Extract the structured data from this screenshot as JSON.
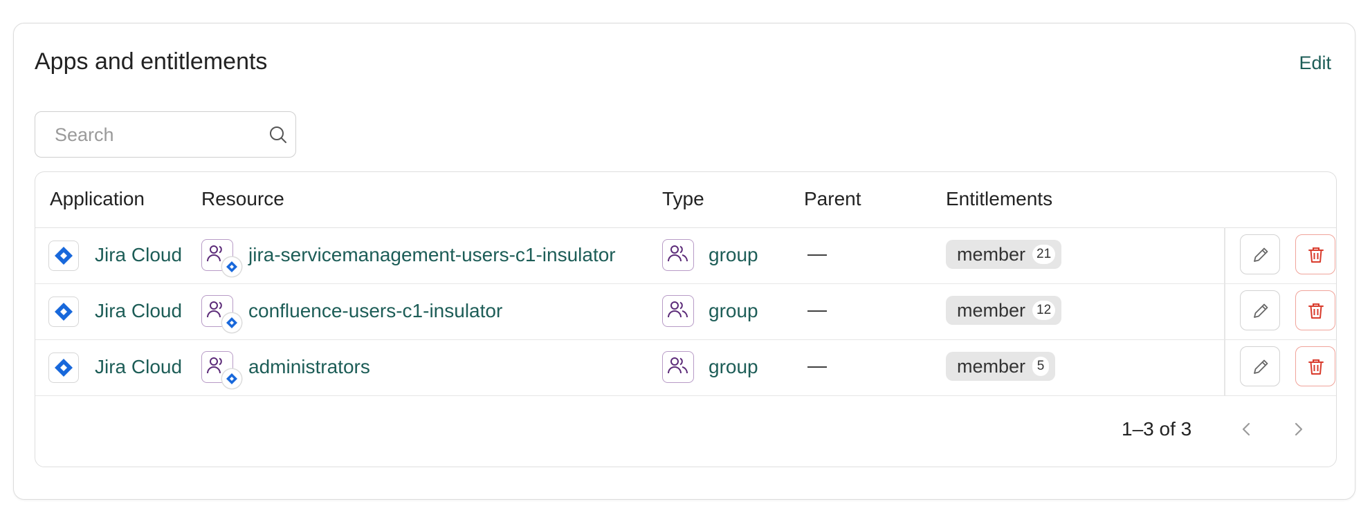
{
  "section": {
    "title": "Apps and entitlements",
    "edit_label": "Edit"
  },
  "search": {
    "placeholder": "Search",
    "value": ""
  },
  "table": {
    "columns": [
      "Application",
      "Resource",
      "Type",
      "Parent",
      "Entitlements"
    ],
    "rows": [
      {
        "application": "Jira Cloud",
        "resource": "jira-servicemanagement-users-c1-insulator",
        "type": "group",
        "parent": "—",
        "entitlement": "member",
        "count": "21"
      },
      {
        "application": "Jira Cloud",
        "resource": "confluence-users-c1-insulator",
        "type": "group",
        "parent": "—",
        "entitlement": "member",
        "count": "12"
      },
      {
        "application": "Jira Cloud",
        "resource": "administrators",
        "type": "group",
        "parent": "—",
        "entitlement": "member",
        "count": "5"
      }
    ]
  },
  "pagination": {
    "range_text": "1–3 of 3"
  },
  "icons": {
    "app": "jira-diamond-icon",
    "resource": "people-icon",
    "type": "people-icon",
    "edit": "pencil-icon",
    "delete": "trash-icon",
    "search": "search-icon",
    "prev": "chevron-left-icon",
    "next": "chevron-right-icon"
  },
  "colors": {
    "link": "#1d5d57",
    "jira_blue": "#1868db",
    "group_purple": "#5b2a78",
    "delete_red": "#d93a2b"
  }
}
